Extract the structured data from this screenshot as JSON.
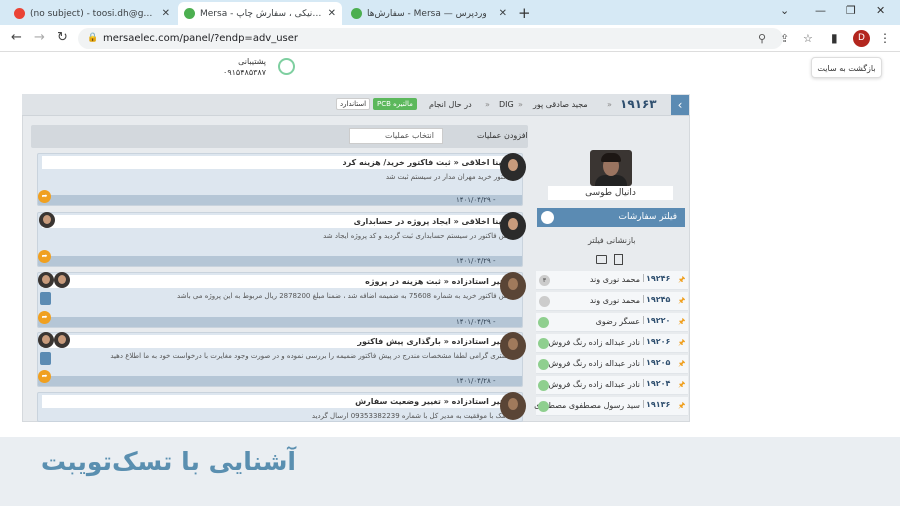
{
  "browser": {
    "tabs": [
      {
        "title": "(no subject) - toosi.dh@gmail.com",
        "fav": "#ea4335",
        "icon": "gmail-icon",
        "active": false
      },
      {
        "title": "Mersa - الکترونیکی ، سفارش چاپ",
        "fav": "#4caf50",
        "icon": "mersa-icon",
        "active": true
      },
      {
        "title": "سفارش‌ها - Mersa — وردپرس",
        "fav": "#4caf50",
        "icon": "wordpress-icon",
        "active": false
      }
    ],
    "url": "mersaelec.com/panel/?endp=adv_user",
    "profile_initial": "D"
  },
  "site": {
    "back_to_site": "بازگشت به سایت",
    "support_label": "پشتیبانی",
    "support_phone": "۰۹۱۵۴۸۵۳۸۷"
  },
  "order": {
    "number": "۱۹۱۶۳",
    "customer": "مجید صادقی پور",
    "type": "DIG",
    "status": "در حال انجام",
    "pcb_badge": "PCB مالتیره",
    "std_badge": "استاندارد"
  },
  "sidebar": {
    "user_name": "دانیال طوسی",
    "filter_title": "فیلتر سفارشات",
    "reset_filter": "بازنشانی فیلتر",
    "orders": [
      {
        "id": "۱۹۲۴۶",
        "name": "محمد نوری وند",
        "badge": "۳"
      },
      {
        "id": "۱۹۲۴۵",
        "name": "محمد نوری وند",
        "badge": ""
      },
      {
        "id": "۱۹۲۲۰",
        "name": "عسگر رضوی",
        "badge": ""
      },
      {
        "id": "۱۹۲۰۶",
        "name": "نادر عبداله زاده رنگ فروش",
        "badge": ""
      },
      {
        "id": "۱۹۲۰۵",
        "name": "نادر عبداله زاده رنگ فروش",
        "badge": ""
      },
      {
        "id": "۱۹۲۰۴",
        "name": "نادر عبداله زاده رنگ فروش",
        "badge": ""
      },
      {
        "id": "۱۹۱۳۶",
        "name": "سید رسول مصطفوی مصطفوی",
        "badge": ""
      }
    ]
  },
  "ops": {
    "add_label": "افزودن عملیات",
    "select_placeholder": "انتخاب عملیات"
  },
  "activities": [
    {
      "author": "مبینا اخلاقی",
      "action": "ثبت فاکتور خرید/ هزینه کرد",
      "desc": "فاکتور خرید مهران مدار در سیستم ثبت شد.",
      "date": "۱۴۰۱/۰۴/۲۹ - ۱۱:۲۳:۲۰"
    },
    {
      "author": "مبینا اخلاقی",
      "action": "ایجاد پروژه در حسابداری",
      "desc": "پیش فاکتور در سیستم حسابداری ثبت گردید و کد پروژه ایجاد شد.",
      "date": "۱۴۰۱/۰۴/۲۹ - ۱۱:۰۴:۰۵"
    },
    {
      "author": "زهیر استادزاده",
      "action": "ثبت هزینه در پروژه",
      "desc": "پیش فاکتور خرید به شماره 75608 به ضمیمه اضافه شد ، ضمنا مبلغ 2878200 ریال مربوط به این پروژه می باشد.",
      "date": "۱۴۰۱/۰۴/۲۹ - ۰۹:۵۲:۳۵"
    },
    {
      "author": "زهیر استادزاده",
      "action": "بارگذاری پیش فاکتور",
      "desc": "مشتری گرامی لطفا مشخصات مندرج در پیش فاکتور ضمیمه را بررسی نموده و در صورت وجود مغایرت با درخواست خود به ما اطلاع دهید.",
      "date": "۱۴۰۱/۰۴/۲۸ - ۰۸:۵۷:۰۹"
    },
    {
      "author": "زهیر استادزاده",
      "action": "تغییر وضعیت سفارش",
      "desc": "پیامک با موفقیت به مدیر کل با شماره 09353382239 ارسال گردید.",
      "date": ""
    }
  ],
  "caption": "آشنایی با تسک‌تویبت"
}
